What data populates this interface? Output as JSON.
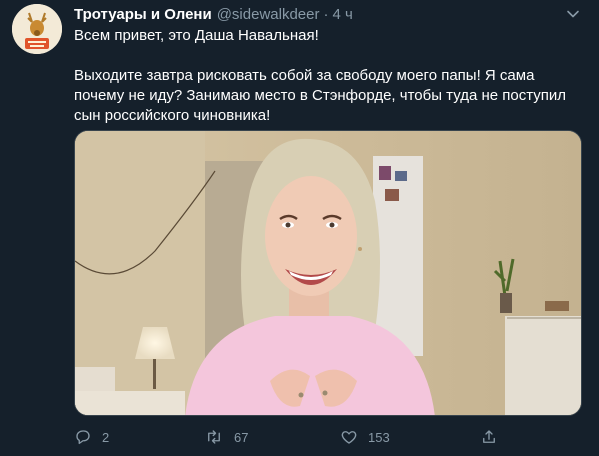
{
  "tweet": {
    "author_name": "Тротуары и Олени",
    "handle": "@sidewalkdeer",
    "separator": "·",
    "time": "4 ч",
    "lines": [
      "Всем привет, это Даша Навальная!",
      "Выходите завтра рисковать собой за свободу моего папы! Я сама почему не иду? Занимаю место в Стэнфорде, чтобы туда не поступил сын российского чиновника!"
    ],
    "media_icon": "video-still-photo"
  },
  "actions": {
    "reply_count": "2",
    "retweet_count": "67",
    "like_count": "153"
  },
  "icons": {
    "reply": "reply-icon",
    "retweet": "retweet-icon",
    "like": "heart-icon",
    "share": "share-icon",
    "more": "chevron-down-icon"
  },
  "colors": {
    "background": "#15202b",
    "secondary_text": "#8899a6",
    "border": "#38444d"
  }
}
